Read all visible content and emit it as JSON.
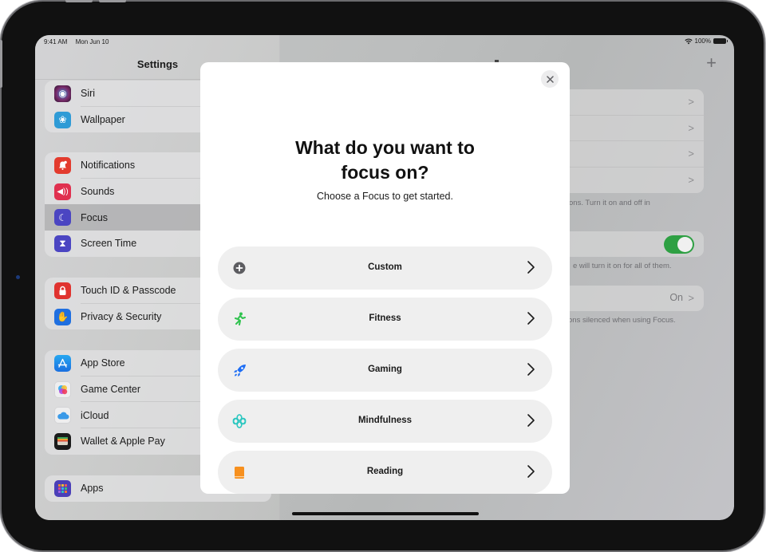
{
  "status_bar": {
    "time": "9:41 AM",
    "date": "Mon Jun 10",
    "battery": "100%"
  },
  "sidebar": {
    "title": "Settings",
    "groups": [
      {
        "items": [
          {
            "label": "Siri",
            "icon": "siri-icon",
            "color": "#7a2b6a"
          },
          {
            "label": "Wallpaper",
            "icon": "wallpaper-flower-icon",
            "color": "#2f9bd6"
          }
        ]
      },
      {
        "items": [
          {
            "label": "Notifications",
            "icon": "bell-icon",
            "color": "#e33b2e"
          },
          {
            "label": "Sounds",
            "icon": "speaker-icon",
            "color": "#e0304f"
          },
          {
            "label": "Focus",
            "icon": "moon-icon",
            "color": "#4b45c2",
            "selected": true
          },
          {
            "label": "Screen Time",
            "icon": "hourglass-icon",
            "color": "#4b45c2"
          }
        ]
      },
      {
        "items": [
          {
            "label": "Touch ID & Passcode",
            "icon": "lock-icon",
            "color": "#e0332f"
          },
          {
            "label": "Privacy & Security",
            "icon": "hand-icon",
            "color": "#1f6fe0"
          }
        ]
      },
      {
        "items": [
          {
            "label": "App Store",
            "icon": "app-store-icon",
            "color": "#1c84e8"
          },
          {
            "label": "Game Center",
            "icon": "game-center-icon",
            "color": "#eeeeef"
          },
          {
            "label": "iCloud",
            "icon": "cloud-icon",
            "color": "#eeeeef"
          },
          {
            "label": "Wallet & Apple Pay",
            "icon": "wallet-icon",
            "color": "#1b1b1b"
          }
        ]
      },
      {
        "items": [
          {
            "label": "Apps",
            "icon": "apps-grid-icon",
            "color": "#4b3fb8"
          }
        ]
      }
    ]
  },
  "detail": {
    "captions": {
      "focus_list": "ons. Turn it on and off in",
      "share_across": "e will turn it on for all of them.",
      "silenced": "ons silenced when using Focus."
    },
    "toggle_on": true,
    "status_value": "On"
  },
  "modal": {
    "title": "What do you want to focus on?",
    "subtitle": "Choose a Focus to get started.",
    "options": [
      {
        "label": "Custom",
        "icon": "plus-circle-icon",
        "color": "#5c5c60"
      },
      {
        "label": "Fitness",
        "icon": "running-figure-icon",
        "color": "#30c34f"
      },
      {
        "label": "Gaming",
        "icon": "rocket-icon",
        "color": "#1e6ef5"
      },
      {
        "label": "Mindfulness",
        "icon": "flower-icon",
        "color": "#2cc7c0"
      },
      {
        "label": "Reading",
        "icon": "book-icon",
        "color": "#f7901e"
      }
    ]
  }
}
